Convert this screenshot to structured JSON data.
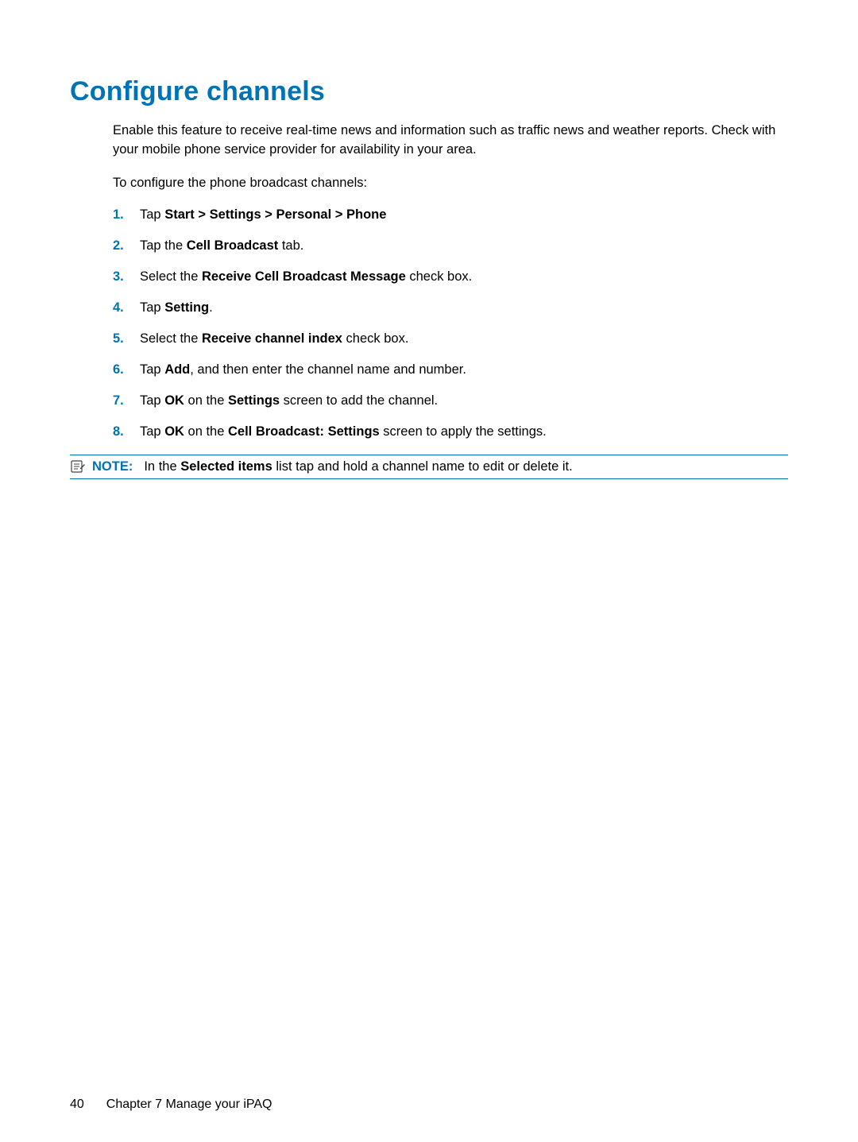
{
  "heading": "Configure channels",
  "intro1": "Enable this feature to receive real-time news and information such as traffic news and weather reports. Check with your mobile phone service provider for availability in your area.",
  "intro2": "To configure the phone broadcast channels:",
  "steps": [
    {
      "num": "1.",
      "pre": "Tap ",
      "bold": "Start > Settings > Personal > Phone",
      "post": ""
    },
    {
      "num": "2.",
      "pre": "Tap the ",
      "bold": "Cell Broadcast",
      "post": " tab."
    },
    {
      "num": "3.",
      "pre": "Select the ",
      "bold": "Receive Cell Broadcast Message",
      "post": " check box."
    },
    {
      "num": "4.",
      "pre": "Tap ",
      "bold": "Setting",
      "post": "."
    },
    {
      "num": "5.",
      "pre": "Select the ",
      "bold": "Receive channel index",
      "post": " check box."
    },
    {
      "num": "6.",
      "pre": "Tap ",
      "bold": "Add",
      "post": ", and then enter the channel name and number."
    },
    {
      "num": "7.",
      "pre": "Tap ",
      "bold": "OK",
      "post": " on the ",
      "bold2": "Settings",
      "post2": " screen to add the channel."
    },
    {
      "num": "8.",
      "pre": "Tap ",
      "bold": "OK",
      "post": " on the ",
      "bold2": "Cell Broadcast: Settings",
      "post2": " screen to apply the settings."
    }
  ],
  "note": {
    "label": "NOTE:",
    "pre": "In the ",
    "bold": "Selected items",
    "post": " list tap and hold a channel name to edit or delete it."
  },
  "footer": {
    "page": "40",
    "chapter": "Chapter 7   Manage your iPAQ"
  }
}
